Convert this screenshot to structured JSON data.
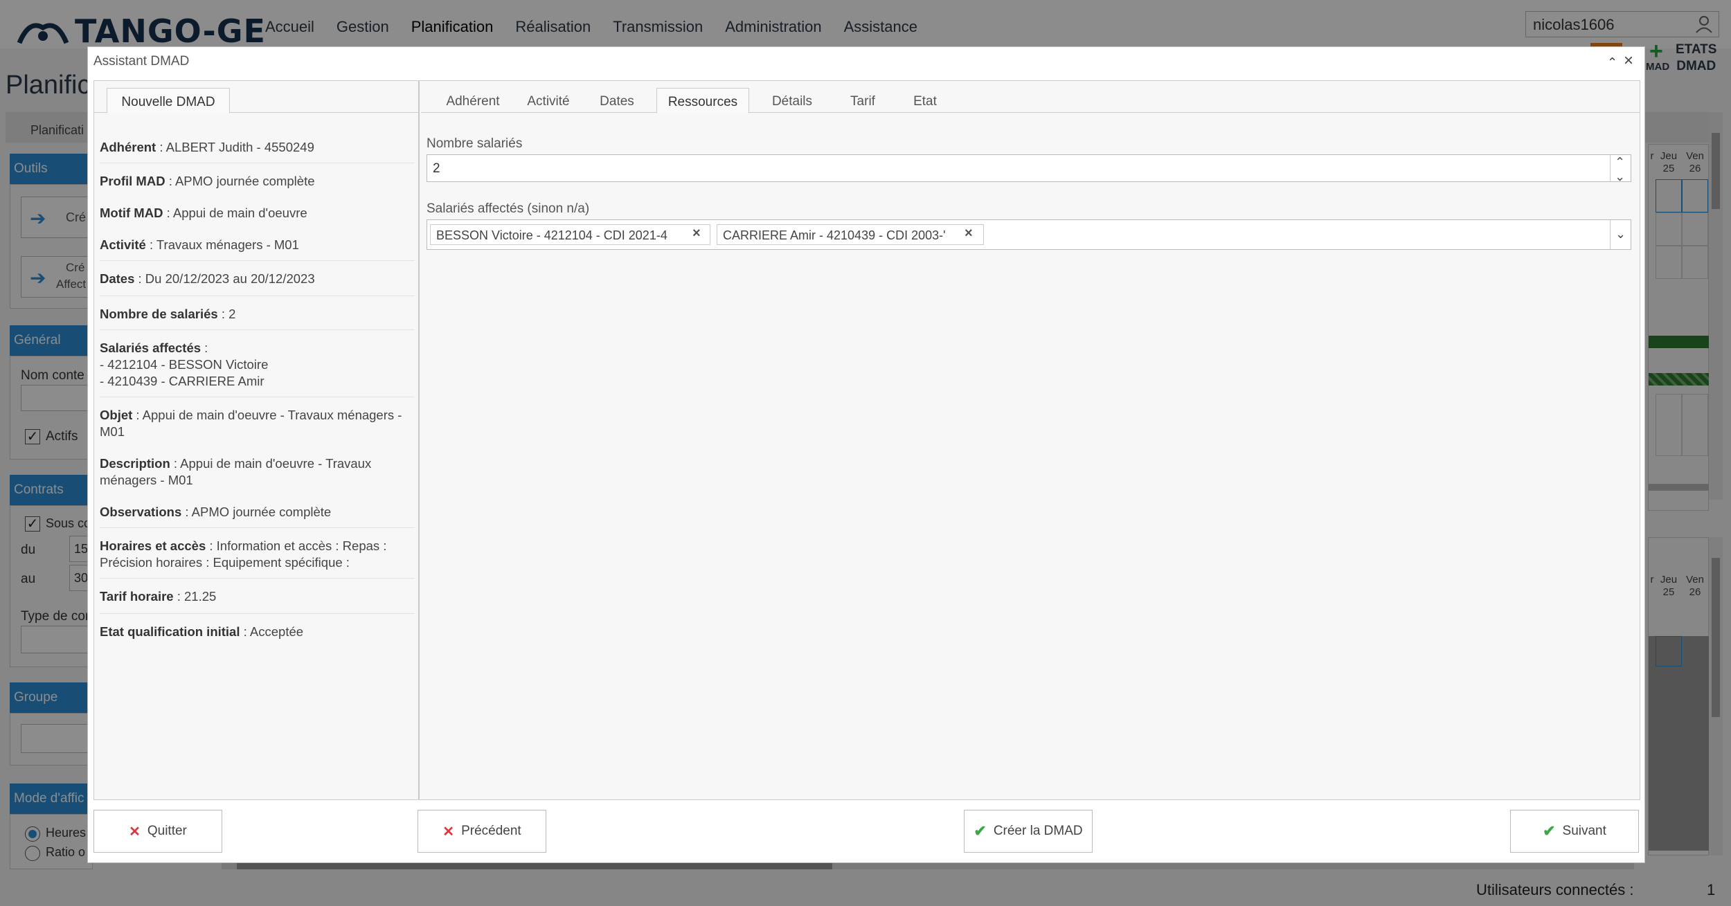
{
  "app": {
    "logo_text": "TANGO-GE",
    "nav": [
      "Accueil",
      "Gestion",
      "Planification",
      "Réalisation",
      "Transmission",
      "Administration",
      "Assistance"
    ],
    "username": "nicolas1606",
    "etats_line1": "ETATS",
    "etats_line2": "DMAD",
    "mad_label": "MAD",
    "page_title": "Planific",
    "planif_tab": "Planificati",
    "status_label": "Utilisateurs connectés :",
    "status_count": "1"
  },
  "sidebar": {
    "outils": "Outils",
    "btn1": "Cré",
    "btn2_l1": "Cré",
    "btn2_l2": "Affect",
    "general": "Général",
    "nom_label": "Nom conte",
    "actifs": "Actifs",
    "contrats": "Contrats",
    "sous_label": "Sous cc",
    "du": "du",
    "du_val": "15",
    "au": "au",
    "au_val": "30",
    "type_label": "Type de cor",
    "groupe": "Groupe",
    "mode": "Mode d'affic",
    "heures": "Heures",
    "ratio": "Ratio o"
  },
  "calendar": {
    "days_top": [
      {
        "d": "r",
        "n": ""
      },
      {
        "d": "Jeu",
        "n": "25"
      },
      {
        "d": "Ven",
        "n": "26"
      }
    ],
    "days_bottom": [
      {
        "d": "r",
        "n": ""
      },
      {
        "d": "Jeu",
        "n": "25"
      },
      {
        "d": "Ven",
        "n": "26"
      }
    ],
    "colors": {
      "green": "#2e7d32",
      "blue_sel": "#2c8fd6"
    }
  },
  "dialog": {
    "title": "Assistant DMAD",
    "left_tab": "Nouvelle DMAD",
    "tabs": [
      "Adhérent",
      "Activité",
      "Dates",
      "Ressources",
      "Détails",
      "Tarif",
      "Etat"
    ],
    "active_tab": "Ressources",
    "summary": {
      "adherent_k": "Adhérent",
      "adherent_v": " : ALBERT Judith - 4550249",
      "profil_k": "Profil MAD",
      "profil_v": " : APMO journée complète",
      "motif_k": "Motif MAD",
      "motif_v": " : Appui de main d'oeuvre",
      "activite_k": "Activité",
      "activite_v": " : Travaux ménagers - M01",
      "dates_k": "Dates",
      "dates_v": " : Du 20/12/2023 au 20/12/2023",
      "nb_k": "Nombre de salariés",
      "nb_v": " : 2",
      "sal_k": "Salariés affectés",
      "sal_v": " :",
      "sal_1": "- 4212104 - BESSON Victoire",
      "sal_2": "- 4210439 - CARRIERE Amir",
      "objet_k": "Objet",
      "objet_v": " : Appui de main d'oeuvre - Travaux ménagers - M01",
      "desc_k": "Description",
      "desc_v": " : Appui de main d'oeuvre - Travaux ménagers - M01",
      "obs_k": "Observations",
      "obs_v": " : APMO journée complète",
      "hor_k": "Horaires et accès",
      "hor_v": " : Information et accès : Repas : Précision horaires : Equipement spécifique :",
      "tarif_k": "Tarif horaire",
      "tarif_v": " : 21.25",
      "etat_k": "Etat qualification initial",
      "etat_v": " : Acceptée"
    },
    "ressources": {
      "nb_label": "Nombre salariés",
      "nb_value": "2",
      "sal_label": "Salariés affectés (sinon n/a)",
      "chips": [
        "BESSON Victoire - 4212104 - CDI 2021-4",
        "CARRIERE Amir - 4210439 - CDI 2003-'"
      ]
    },
    "buttons": {
      "quit": "Quitter",
      "prev": "Précédent",
      "create": "Créer la DMAD",
      "next": "Suivant"
    }
  }
}
